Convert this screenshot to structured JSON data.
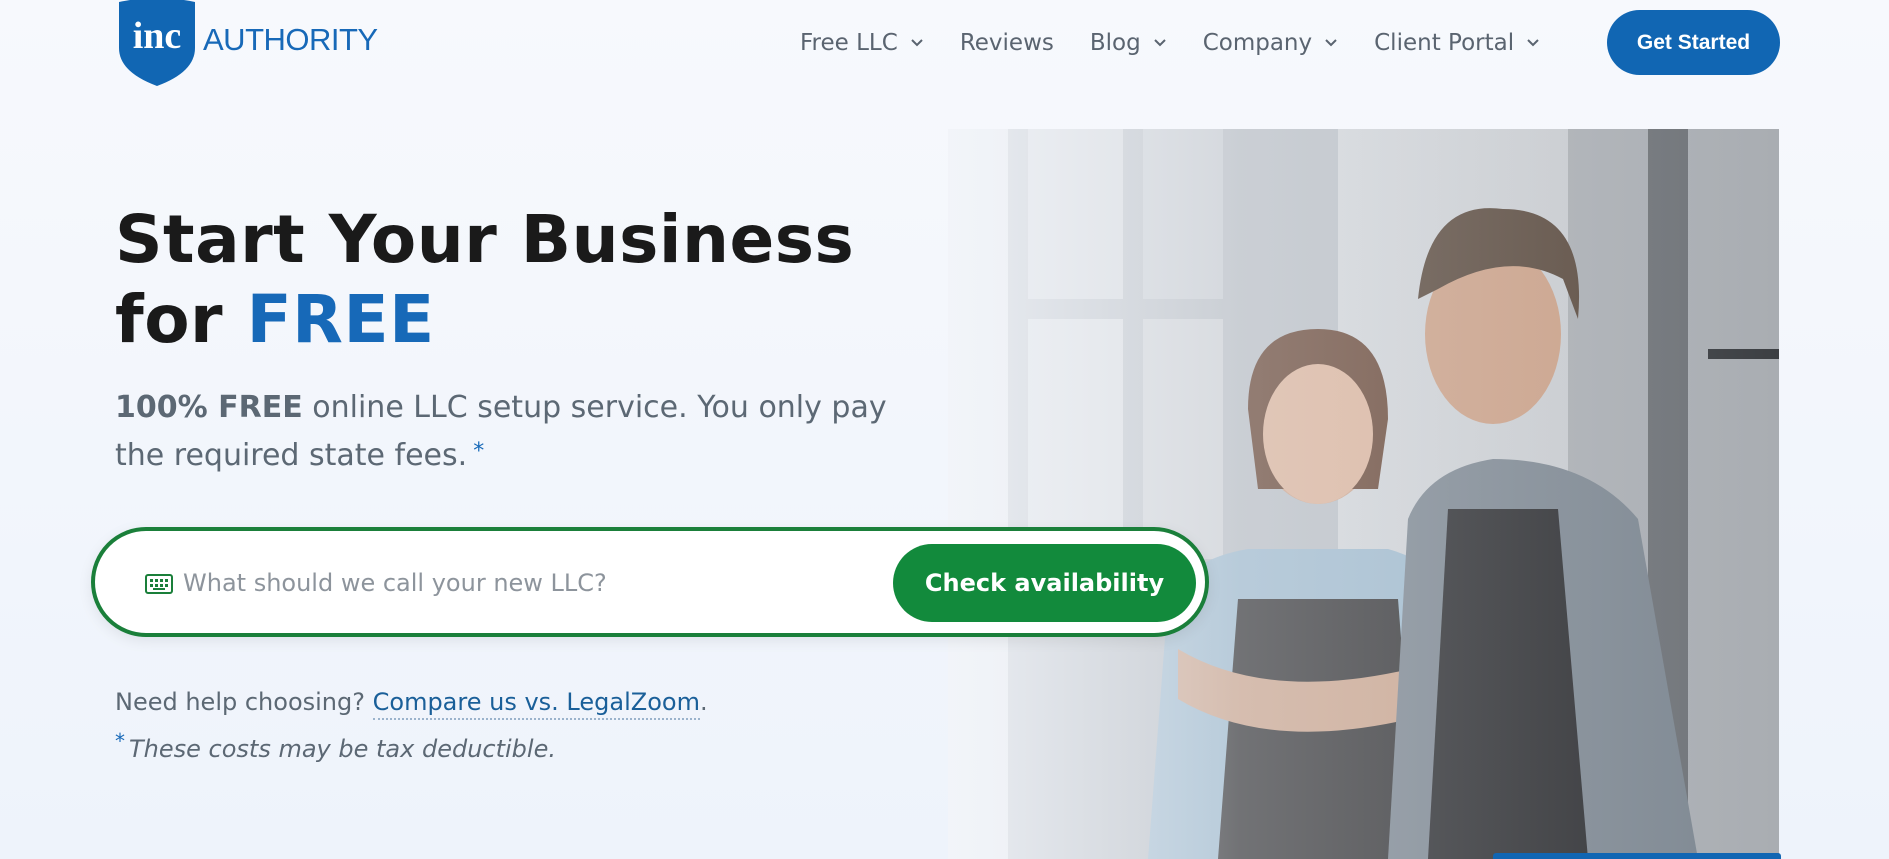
{
  "header": {
    "logo_badge": "inc",
    "logo_text": "AUTHORITY",
    "nav": [
      {
        "label": "Free LLC",
        "dropdown": true
      },
      {
        "label": "Reviews",
        "dropdown": false
      },
      {
        "label": "Blog",
        "dropdown": true
      },
      {
        "label": "Company",
        "dropdown": true
      },
      {
        "label": "Client Portal",
        "dropdown": true
      }
    ],
    "cta_label": "Get Started"
  },
  "hero": {
    "headline_line1": "Start Your Business",
    "headline_for": "for",
    "headline_free": "FREE",
    "sub_bold": "100% FREE",
    "sub_text": "online LLC setup service. You only pay the required state fees.",
    "sub_asterisk": "*"
  },
  "search": {
    "placeholder": "What should we call your new LLC?",
    "value": "",
    "button_label": "Check availability",
    "icon": "keyboard-icon"
  },
  "help": {
    "prefix": "Need help choosing?",
    "link": "Compare us vs. LegalZoom",
    "suffix": "."
  },
  "footnote": {
    "asterisk": "*",
    "text": "These costs may be tax deductible."
  },
  "colors": {
    "brand_blue": "#1166b3",
    "accent_green": "#128a3c",
    "text_gray": "#5c6874"
  }
}
